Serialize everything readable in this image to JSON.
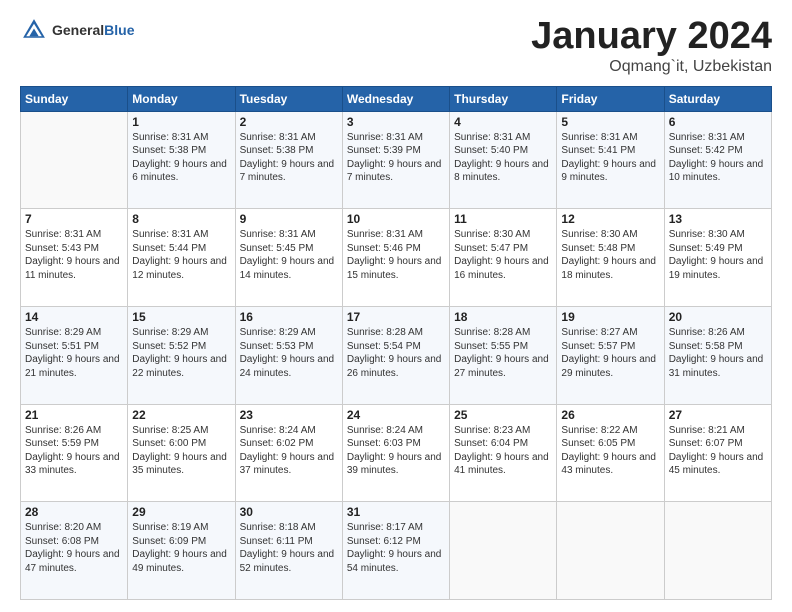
{
  "logo": {
    "general": "General",
    "blue": "Blue"
  },
  "header": {
    "title": "January 2024",
    "subtitle": "Oqmang`it, Uzbekistan"
  },
  "weekdays": [
    "Sunday",
    "Monday",
    "Tuesday",
    "Wednesday",
    "Thursday",
    "Friday",
    "Saturday"
  ],
  "weeks": [
    [
      {
        "date": "",
        "sunrise": "",
        "sunset": "",
        "daylight": ""
      },
      {
        "date": "1",
        "sunrise": "Sunrise: 8:31 AM",
        "sunset": "Sunset: 5:38 PM",
        "daylight": "Daylight: 9 hours and 6 minutes."
      },
      {
        "date": "2",
        "sunrise": "Sunrise: 8:31 AM",
        "sunset": "Sunset: 5:38 PM",
        "daylight": "Daylight: 9 hours and 7 minutes."
      },
      {
        "date": "3",
        "sunrise": "Sunrise: 8:31 AM",
        "sunset": "Sunset: 5:39 PM",
        "daylight": "Daylight: 9 hours and 7 minutes."
      },
      {
        "date": "4",
        "sunrise": "Sunrise: 8:31 AM",
        "sunset": "Sunset: 5:40 PM",
        "daylight": "Daylight: 9 hours and 8 minutes."
      },
      {
        "date": "5",
        "sunrise": "Sunrise: 8:31 AM",
        "sunset": "Sunset: 5:41 PM",
        "daylight": "Daylight: 9 hours and 9 minutes."
      },
      {
        "date": "6",
        "sunrise": "Sunrise: 8:31 AM",
        "sunset": "Sunset: 5:42 PM",
        "daylight": "Daylight: 9 hours and 10 minutes."
      }
    ],
    [
      {
        "date": "7",
        "sunrise": "Sunrise: 8:31 AM",
        "sunset": "Sunset: 5:43 PM",
        "daylight": "Daylight: 9 hours and 11 minutes."
      },
      {
        "date": "8",
        "sunrise": "Sunrise: 8:31 AM",
        "sunset": "Sunset: 5:44 PM",
        "daylight": "Daylight: 9 hours and 12 minutes."
      },
      {
        "date": "9",
        "sunrise": "Sunrise: 8:31 AM",
        "sunset": "Sunset: 5:45 PM",
        "daylight": "Daylight: 9 hours and 14 minutes."
      },
      {
        "date": "10",
        "sunrise": "Sunrise: 8:31 AM",
        "sunset": "Sunset: 5:46 PM",
        "daylight": "Daylight: 9 hours and 15 minutes."
      },
      {
        "date": "11",
        "sunrise": "Sunrise: 8:30 AM",
        "sunset": "Sunset: 5:47 PM",
        "daylight": "Daylight: 9 hours and 16 minutes."
      },
      {
        "date": "12",
        "sunrise": "Sunrise: 8:30 AM",
        "sunset": "Sunset: 5:48 PM",
        "daylight": "Daylight: 9 hours and 18 minutes."
      },
      {
        "date": "13",
        "sunrise": "Sunrise: 8:30 AM",
        "sunset": "Sunset: 5:49 PM",
        "daylight": "Daylight: 9 hours and 19 minutes."
      }
    ],
    [
      {
        "date": "14",
        "sunrise": "Sunrise: 8:29 AM",
        "sunset": "Sunset: 5:51 PM",
        "daylight": "Daylight: 9 hours and 21 minutes."
      },
      {
        "date": "15",
        "sunrise": "Sunrise: 8:29 AM",
        "sunset": "Sunset: 5:52 PM",
        "daylight": "Daylight: 9 hours and 22 minutes."
      },
      {
        "date": "16",
        "sunrise": "Sunrise: 8:29 AM",
        "sunset": "Sunset: 5:53 PM",
        "daylight": "Daylight: 9 hours and 24 minutes."
      },
      {
        "date": "17",
        "sunrise": "Sunrise: 8:28 AM",
        "sunset": "Sunset: 5:54 PM",
        "daylight": "Daylight: 9 hours and 26 minutes."
      },
      {
        "date": "18",
        "sunrise": "Sunrise: 8:28 AM",
        "sunset": "Sunset: 5:55 PM",
        "daylight": "Daylight: 9 hours and 27 minutes."
      },
      {
        "date": "19",
        "sunrise": "Sunrise: 8:27 AM",
        "sunset": "Sunset: 5:57 PM",
        "daylight": "Daylight: 9 hours and 29 minutes."
      },
      {
        "date": "20",
        "sunrise": "Sunrise: 8:26 AM",
        "sunset": "Sunset: 5:58 PM",
        "daylight": "Daylight: 9 hours and 31 minutes."
      }
    ],
    [
      {
        "date": "21",
        "sunrise": "Sunrise: 8:26 AM",
        "sunset": "Sunset: 5:59 PM",
        "daylight": "Daylight: 9 hours and 33 minutes."
      },
      {
        "date": "22",
        "sunrise": "Sunrise: 8:25 AM",
        "sunset": "Sunset: 6:00 PM",
        "daylight": "Daylight: 9 hours and 35 minutes."
      },
      {
        "date": "23",
        "sunrise": "Sunrise: 8:24 AM",
        "sunset": "Sunset: 6:02 PM",
        "daylight": "Daylight: 9 hours and 37 minutes."
      },
      {
        "date": "24",
        "sunrise": "Sunrise: 8:24 AM",
        "sunset": "Sunset: 6:03 PM",
        "daylight": "Daylight: 9 hours and 39 minutes."
      },
      {
        "date": "25",
        "sunrise": "Sunrise: 8:23 AM",
        "sunset": "Sunset: 6:04 PM",
        "daylight": "Daylight: 9 hours and 41 minutes."
      },
      {
        "date": "26",
        "sunrise": "Sunrise: 8:22 AM",
        "sunset": "Sunset: 6:05 PM",
        "daylight": "Daylight: 9 hours and 43 minutes."
      },
      {
        "date": "27",
        "sunrise": "Sunrise: 8:21 AM",
        "sunset": "Sunset: 6:07 PM",
        "daylight": "Daylight: 9 hours and 45 minutes."
      }
    ],
    [
      {
        "date": "28",
        "sunrise": "Sunrise: 8:20 AM",
        "sunset": "Sunset: 6:08 PM",
        "daylight": "Daylight: 9 hours and 47 minutes."
      },
      {
        "date": "29",
        "sunrise": "Sunrise: 8:19 AM",
        "sunset": "Sunset: 6:09 PM",
        "daylight": "Daylight: 9 hours and 49 minutes."
      },
      {
        "date": "30",
        "sunrise": "Sunrise: 8:18 AM",
        "sunset": "Sunset: 6:11 PM",
        "daylight": "Daylight: 9 hours and 52 minutes."
      },
      {
        "date": "31",
        "sunrise": "Sunrise: 8:17 AM",
        "sunset": "Sunset: 6:12 PM",
        "daylight": "Daylight: 9 hours and 54 minutes."
      },
      {
        "date": "",
        "sunrise": "",
        "sunset": "",
        "daylight": ""
      },
      {
        "date": "",
        "sunrise": "",
        "sunset": "",
        "daylight": ""
      },
      {
        "date": "",
        "sunrise": "",
        "sunset": "",
        "daylight": ""
      }
    ]
  ]
}
